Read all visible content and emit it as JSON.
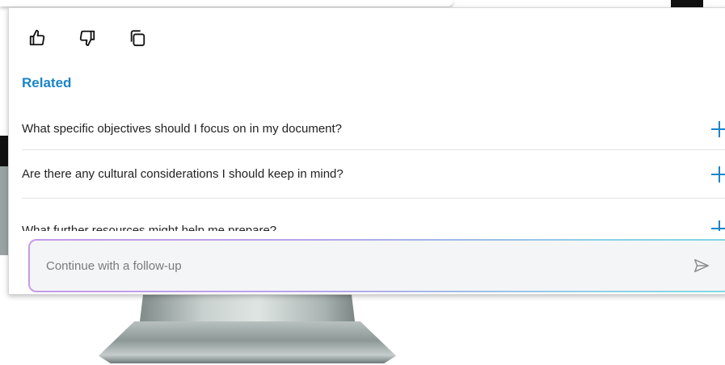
{
  "feedback": {
    "icons": [
      "thumbs-up-icon",
      "thumbs-down-icon",
      "copy-icon"
    ]
  },
  "related": {
    "title": "Related",
    "items": [
      {
        "label": "What specific objectives should I focus on in my document?"
      },
      {
        "label": "Are there any cultural considerations I should keep in mind?"
      },
      {
        "label": "What further resources might help me prepare?"
      }
    ]
  },
  "followup": {
    "placeholder": "Continue with a follow-up"
  },
  "colors": {
    "accent": "#1a84c8",
    "input_gradient_start": "#c69ae8",
    "input_gradient_end": "#7fd8e0"
  }
}
